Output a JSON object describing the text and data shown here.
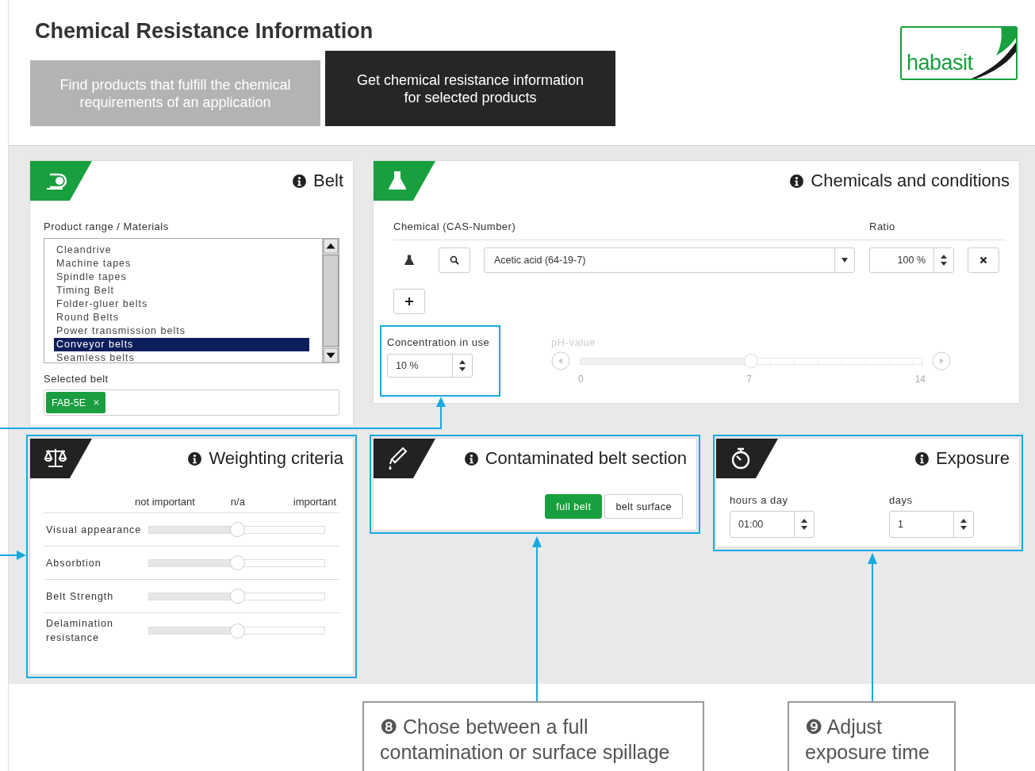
{
  "page": {
    "title": "Chemical Resistance Information",
    "logo": "habasit"
  },
  "tabs": [
    {
      "label": "Find products that fulfill the chemical requirements of an application",
      "selected": false
    },
    {
      "label": "Get chemical resistance information for selected products",
      "selected": true
    }
  ],
  "belt_panel": {
    "title": "Belt",
    "list_label": "Product range / Materials",
    "items": [
      {
        "label": "Cleandrive",
        "selected": false
      },
      {
        "label": "Machine tapes",
        "selected": false
      },
      {
        "label": "Spindle tapes",
        "selected": false
      },
      {
        "label": "Timing Belt",
        "selected": false
      },
      {
        "label": "Folder-gluer belts",
        "selected": false
      },
      {
        "label": "Round Belts",
        "selected": false
      },
      {
        "label": "Power transmission belts",
        "selected": false
      },
      {
        "label": "Conveyor belts",
        "selected": true
      },
      {
        "label": "Seamless belts",
        "selected": false
      }
    ],
    "selected_label": "Selected belt",
    "tags": [
      "FAB-5E"
    ]
  },
  "chemicals_panel": {
    "title": "Chemicals and conditions",
    "chemical_label": "Chemical (CAS-Number)",
    "ratio_label": "Ratio",
    "rows": [
      {
        "chemical": "Acetic acid (64-19-7)",
        "ratio": "100 %"
      }
    ],
    "concentration": {
      "label": "Concentration in use",
      "value": "10 %",
      "highlighted": true
    },
    "ph": {
      "label": "pH-value",
      "level": 0.5,
      "disabled": true,
      "ticks": [
        "0",
        "7",
        "14"
      ]
    }
  },
  "weighting_panel": {
    "title": "Weighting criteria",
    "highlighted": true,
    "scale": [
      "not important",
      "n/a",
      "important"
    ],
    "criteria": [
      {
        "label": "Visual appearance",
        "level": 0.5
      },
      {
        "label": "Absorbtion",
        "level": 0.5
      },
      {
        "label": "Belt Strength",
        "level": 0.5
      },
      {
        "label": "Delamination resistance",
        "level": 0.5
      }
    ]
  },
  "contamination_panel": {
    "title": "Contaminated belt section",
    "highlighted": true,
    "options": [
      {
        "label": "full belt",
        "selected": true
      },
      {
        "label": "belt surface",
        "selected": false
      }
    ]
  },
  "exposure_panel": {
    "title": "Exposure",
    "highlighted": true,
    "fields": [
      {
        "label": "hours a day",
        "value": "01:00"
      },
      {
        "label": "days",
        "value": "1"
      }
    ]
  },
  "callouts": [
    {
      "text": "❽ Chose between a full contamination or surface spillage"
    },
    {
      "text": "❾ Adjust exposure time"
    }
  ]
}
